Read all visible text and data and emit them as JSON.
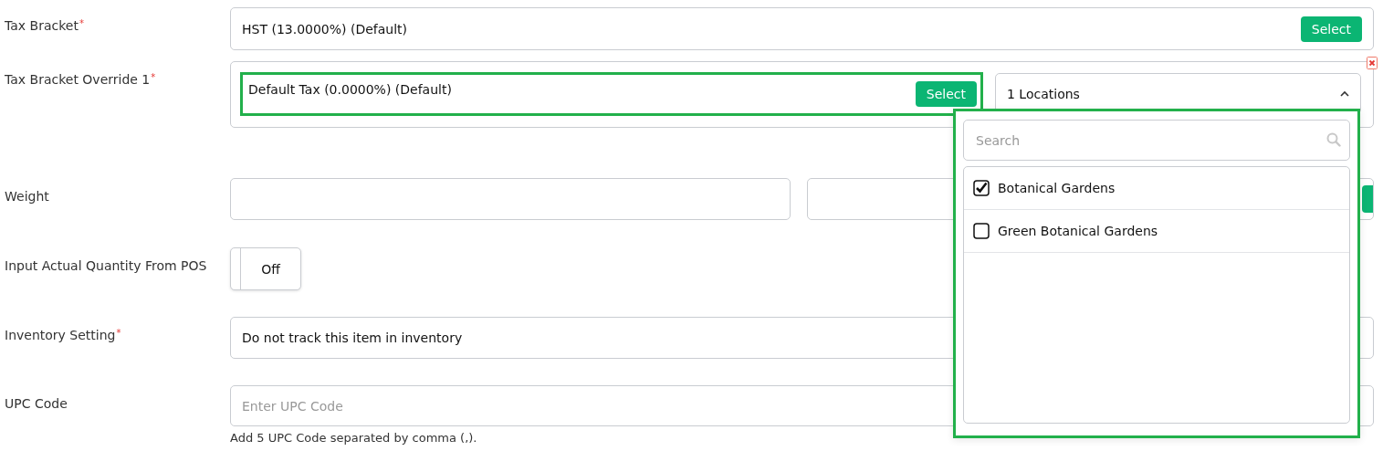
{
  "fields": [
    {
      "kind": "select-button",
      "label": "Tax Bracket",
      "required_mark": "*",
      "value": "HST (13.0000%) (Default)",
      "button": "Select"
    },
    {
      "kind": "override",
      "label": "Tax Bracket Override 1",
      "required_mark": "*",
      "value": "Default Tax (0.0000%) (Default)",
      "button": "Select",
      "highlighted": true,
      "locations": "1 Locations",
      "expanded": true
    },
    {
      "kind": "pair",
      "label": "Weight"
    },
    {
      "kind": "toggle",
      "label": "Input Actual Quantity From POS",
      "on": false,
      "state_text": "Off"
    },
    {
      "kind": "select",
      "label": "Inventory Setting",
      "required_mark": "*",
      "value": "Do not track this item in inventory"
    },
    {
      "kind": "text",
      "label": "UPC Code",
      "placeholder": "Enter UPC Code",
      "help": "Add 5 UPC Code separated by comma (,)."
    }
  ],
  "dropdown": {
    "highlighted": true,
    "search_placeholder": "Search",
    "options": [
      {
        "label": "Botanical Gardens",
        "checked": true
      },
      {
        "label": "Green Botanical Gardens",
        "checked": false
      }
    ]
  }
}
